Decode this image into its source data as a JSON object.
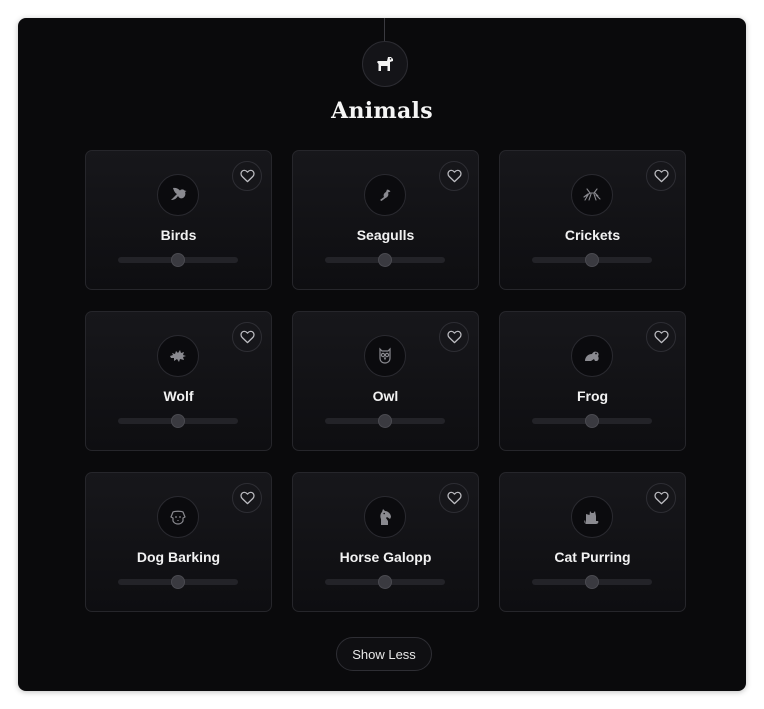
{
  "category": {
    "title": "Animals",
    "icon": "dog-icon"
  },
  "sounds": [
    {
      "label": "Birds",
      "icon": "bird-icon",
      "volume": 0.5,
      "favorited": false
    },
    {
      "label": "Seagulls",
      "icon": "seagull-icon",
      "volume": 0.5,
      "favorited": false
    },
    {
      "label": "Crickets",
      "icon": "cricket-icon",
      "volume": 0.5,
      "favorited": false
    },
    {
      "label": "Wolf",
      "icon": "wolf-icon",
      "volume": 0.5,
      "favorited": false
    },
    {
      "label": "Owl",
      "icon": "owl-icon",
      "volume": 0.5,
      "favorited": false
    },
    {
      "label": "Frog",
      "icon": "frog-icon",
      "volume": 0.5,
      "favorited": false
    },
    {
      "label": "Dog Barking",
      "icon": "dog-face-icon",
      "volume": 0.5,
      "favorited": false
    },
    {
      "label": "Horse Galopp",
      "icon": "horse-icon",
      "volume": 0.5,
      "favorited": false
    },
    {
      "label": "Cat Purring",
      "icon": "cat-icon",
      "volume": 0.5,
      "favorited": false
    }
  ],
  "actions": {
    "show_less_label": "Show Less"
  }
}
